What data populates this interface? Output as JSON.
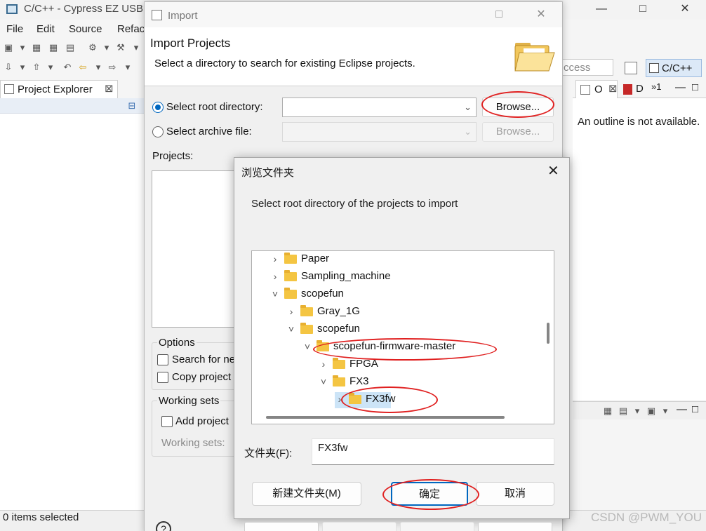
{
  "eclipse": {
    "title": "C/C++ - Cypress EZ USB S",
    "menu": [
      "File",
      "Edit",
      "Source",
      "Refac"
    ],
    "project_explorer_tab": "Project Explorer",
    "quick_access": "ccess",
    "perspective": "C/C++",
    "outline_tab": "O",
    "d_tab": "D",
    "extra_tab": "»1",
    "outline_message": "An outline is not available.",
    "status": "0 items selected"
  },
  "import_dialog": {
    "window_title": "Import",
    "heading": "Import Projects",
    "subtitle": "Select a directory to search for existing Eclipse projects.",
    "root_dir_label": "Select root directory:",
    "archive_label": "Select archive file:",
    "browse_label": "Browse...",
    "browse_disabled_label": "Browse...",
    "projects_label": "Projects:",
    "options_label": "Options",
    "search_label": "Search for ne",
    "copy_label": "Copy project",
    "working_sets_label": "Working sets",
    "add_project_label": "Add project",
    "working_sets_field_label": "Working sets:"
  },
  "browse_dialog": {
    "title": "浏览文件夹",
    "description": "Select root directory of the projects to import",
    "tree": [
      {
        "name": "Paper",
        "depth": 0,
        "expanded": false,
        "selected": false
      },
      {
        "name": "Sampling_machine",
        "depth": 0,
        "expanded": false,
        "selected": false
      },
      {
        "name": "scopefun",
        "depth": 0,
        "expanded": true,
        "selected": false
      },
      {
        "name": "Gray_1G",
        "depth": 1,
        "expanded": false,
        "selected": false
      },
      {
        "name": "scopefun",
        "depth": 1,
        "expanded": true,
        "selected": false
      },
      {
        "name": "scopefun-firmware-master",
        "depth": 2,
        "expanded": true,
        "selected": false
      },
      {
        "name": "FPGA",
        "depth": 3,
        "expanded": false,
        "selected": false
      },
      {
        "name": "FX3",
        "depth": 3,
        "expanded": true,
        "selected": false
      },
      {
        "name": "FX3fw",
        "depth": 4,
        "expanded": false,
        "selected": true
      }
    ],
    "folder_label": "文件夹(F):",
    "folder_value": "FX3fw",
    "new_folder_label": "新建文件夹(M)",
    "ok_label": "确定",
    "cancel_label": "取消"
  },
  "watermark": "CSDN @PWM_YOU",
  "colors": {
    "accent": "#0067c0",
    "annotation": "#e02020",
    "folder": "#f4c542",
    "selection": "#cce4f7"
  }
}
